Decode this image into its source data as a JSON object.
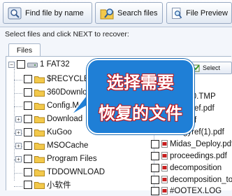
{
  "toolbar": {
    "find_by_name": "Find file by name",
    "search_files": "Search files",
    "file_preview": "File Preview"
  },
  "instruction": "Select files and click NEXT to recover:",
  "tabs": {
    "files": "Files"
  },
  "tree": {
    "root": "1 FAT32",
    "folders": [
      "$RECYCLE",
      "360Downlo",
      "Config.Ms",
      "Download",
      "KuGoo",
      "MSOCache",
      "Program Files",
      "TDDOWNLOAD",
      "小软件"
    ]
  },
  "file_panel": {
    "select_label": "Select",
    "files": [
      "420.TMP",
      "gyref.pdf",
      ".pdf",
      "gyref(1).pdf",
      "Midas_Deploy.pdf",
      "proceedings.pdf",
      "decomposition",
      "decomposition_too",
      "#OOTEX.LOG"
    ]
  },
  "callout": {
    "line1": "选择需要",
    "line2": "恢复的文件",
    "color": "#1f7fd6"
  }
}
